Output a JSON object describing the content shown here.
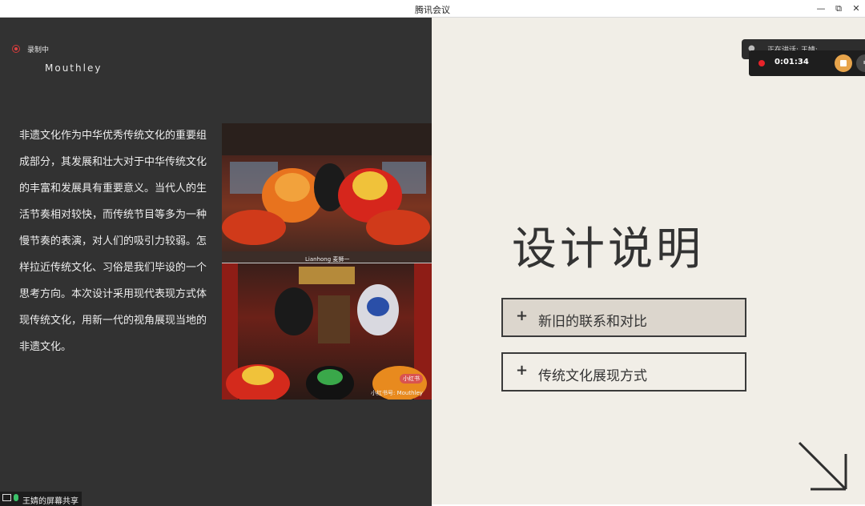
{
  "window": {
    "title": "腾讯会议",
    "minimize_glyph": "—",
    "maximize_glyph": "⧉",
    "close_glyph": "✕"
  },
  "recording": {
    "status_label": "录制中",
    "elapsed": "0:01:34",
    "speaking_text": "正在讲话: 王婧;",
    "dot_color": "#e8232a",
    "stop_color": "#e7a44b"
  },
  "slide_left": {
    "brand": "Mouthley",
    "body": "非遗文化作为中华优秀传统文化的重要组成部分，其发展和壮大对于中华传统文化的丰富和发展具有重要意义。当代人的生活节奏相对较快，而传统节目等多为一种慢节奏的表演，对人们的吸引力较弱。怎样拉近传统文化、习俗是我们毕设的一个思考方向。本次设计采用现代表现方式体现传统文化，用新一代的视角展现当地的非遗文化。",
    "photo_top_caption": "Lianhong 麦狮一",
    "photo_bottom_caption": "小红书号: Mouthley",
    "photo_badge": "小红书",
    "background": "#323232"
  },
  "slide_right": {
    "title": "设计说明",
    "options": [
      {
        "icon": "plus-icon",
        "label": "新旧的联系和对比"
      },
      {
        "icon": "plus-icon",
        "label": "传统文化展现方式"
      }
    ],
    "arrow_icon": "arrow-down-right-icon",
    "background": "#f1eee7"
  },
  "share_badge": {
    "label": "王婧的屏幕共享"
  }
}
